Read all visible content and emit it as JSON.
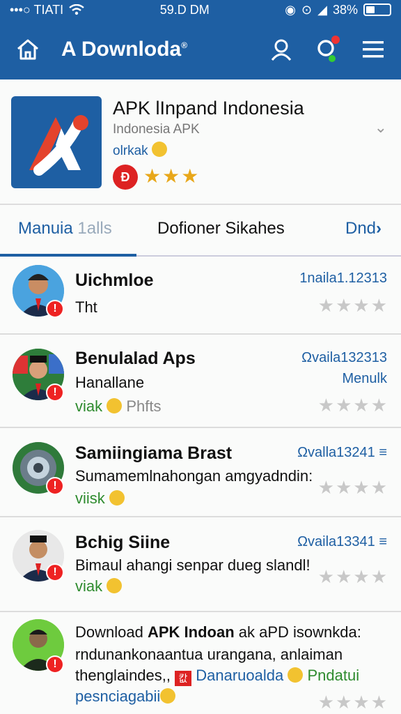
{
  "status_bar": {
    "carrier": "•••○ TIATI",
    "time": "59.D DM",
    "battery_text": "38%",
    "battery_level": 0.38
  },
  "app_bar": {
    "title": "A Downloda",
    "title_mark": "®"
  },
  "app_card": {
    "name": "APK lInpand Indonesia",
    "subtitle": "Indonesia APK",
    "tag": "olrkak",
    "badge": "Đ",
    "stars_text": "★★★",
    "rating": 3,
    "colors": {
      "brand": "#1e5fa3",
      "accent": "#e33"
    }
  },
  "tabs": [
    {
      "label": "Manuia",
      "extra": "1alls",
      "active": true
    },
    {
      "label": "Dofioner Sikahes",
      "active": false
    },
    {
      "label": "Dnd",
      "icon": "chevron-right-icon",
      "active": false
    }
  ],
  "rows": [
    {
      "title": "Uichmloe",
      "line1": "Tht",
      "meta": "1naila1.12313",
      "stars_text": "★★★★",
      "rating": 0
    },
    {
      "title": "Benulalad Aps",
      "line1": "Hanallane",
      "green": "viak",
      "grey": "Phfts",
      "meta": "Ωvaila132313",
      "meta2": "Menulk",
      "stars_text": "★★★★",
      "rating": 0
    },
    {
      "title": "Samiingiama Brast",
      "line1": "Sumamemlnahongan amgyadndin:",
      "green": "viisk",
      "meta": "Ωvalla13241 ≡",
      "stars_text": "★★★★",
      "rating": 0
    },
    {
      "title": "Bchig Siine",
      "line1": "Bimaul ahangi senpar dueg slandl!",
      "green": "viak",
      "meta": "Ωvaila13341 ≡",
      "stars_text": "★★★★",
      "rating": 0
    },
    {
      "line_a_pre": "Download",
      "line_a_bold": "APK Indoan",
      "line_a_post": "ak aPD isownkda:",
      "line_b": "rndunankonaantua urangana, anlaiman",
      "line_c_pre": "thenglaindes,,",
      "line_c_chip": "캆",
      "line_c_blue": "Danaruoalda",
      "line_c_green": "Pndatui",
      "line_d": "pesnciagabii",
      "stars_text": "★★★★",
      "rating": 0
    }
  ]
}
